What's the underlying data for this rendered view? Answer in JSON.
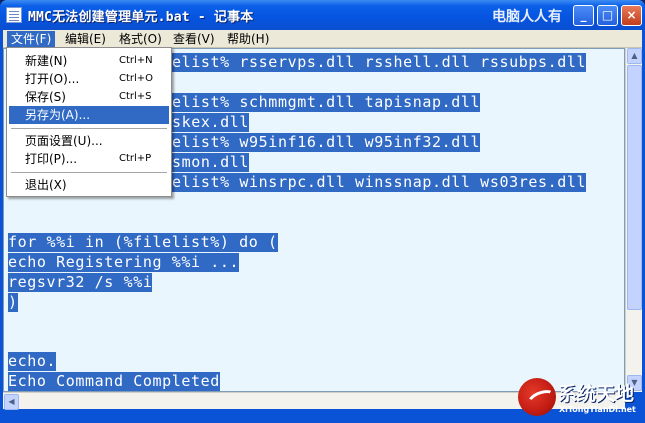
{
  "window": {
    "title": "MMC无法创建管理单元.bat - 记事本",
    "watermark_top": "电脑人人有"
  },
  "controls": {
    "minimize": "_",
    "maximize": "□",
    "close": "×"
  },
  "menubar": {
    "items": [
      {
        "label": "文件(F)"
      },
      {
        "label": "编辑(E)"
      },
      {
        "label": "格式(O)"
      },
      {
        "label": "查看(V)"
      },
      {
        "label": "帮助(H)"
      }
    ]
  },
  "file_menu": {
    "items": [
      {
        "label": "新建(N)",
        "shortcut": "Ctrl+N"
      },
      {
        "label": "打开(O)...",
        "shortcut": "Ctrl+O"
      },
      {
        "label": "保存(S)",
        "shortcut": "Ctrl+S"
      },
      {
        "label": "另存为(A)...",
        "shortcut": ""
      },
      {
        "label": "页面设置(U)...",
        "shortcut": ""
      },
      {
        "label": "打印(P)...",
        "shortcut": "Ctrl+P"
      },
      {
        "label": "退出(X)",
        "shortcut": ""
      }
    ],
    "selected_index": 3
  },
  "editor": {
    "lines": [
      "elist% rsservps.dll rsshell.dll rssubps.dll",
      "elist% schmmgmt.dll tapisnap.dll",
      "skex.dll",
      "elist% w95inf16.dll w95inf32.dll",
      "smon.dll",
      "elist% winsrpc.dll winssnap.dll ws03res.dll",
      "for %%i in (%filelist%) do (",
      "echo Registering %%i ...",
      "regsvr32 /s %%i",
      ")",
      "echo.",
      "Echo Command Completed"
    ]
  },
  "logo": {
    "name": "系统天地",
    "url": "XiTongTianDi.net"
  },
  "colors": {
    "selection": "#316ac5",
    "editor_bg": "#e9f6fd",
    "titlebar": "#0654e0",
    "menubar": "#ece9d8"
  }
}
